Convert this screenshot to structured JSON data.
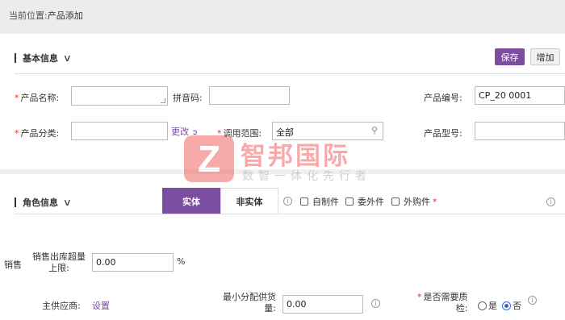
{
  "breadcrumb": {
    "prefix": "当前位置:",
    "current": "产品添加"
  },
  "basic_section": {
    "title": "基本信息",
    "save_label": "保存",
    "add_label": "增加"
  },
  "fields": {
    "product_name": {
      "label": "产品名称:",
      "value": ""
    },
    "pinyin": {
      "label": "拼音码:",
      "value": ""
    },
    "product_code": {
      "label": "产品编号:",
      "value": "CP_20          0001"
    },
    "category": {
      "label": "产品分类:",
      "value": "",
      "change_link": "更改"
    },
    "scope": {
      "label": "调用范围:",
      "value": "全部"
    },
    "model": {
      "label": "产品型号:",
      "value": ""
    }
  },
  "role_section": {
    "title": "角色信息",
    "tabs": [
      {
        "label": "实体"
      },
      {
        "label": "非实体"
      }
    ],
    "checkboxes": [
      {
        "label": "自制件"
      },
      {
        "label": "委外件"
      },
      {
        "label": "外购件"
      }
    ],
    "required_mark": "*"
  },
  "sales": {
    "side_label": "销售",
    "overlimit_label_line1": "销售出库超量",
    "overlimit_label_line2": "上限:",
    "overlimit_value": "0.00",
    "overlimit_unit": "%",
    "supplier_label": "主供应商:",
    "supplier_link": "设置",
    "min_alloc_label_line1": "最小分配供货",
    "min_alloc_label_line2": "量:",
    "min_alloc_value": "0.00",
    "qc_label_line1": "是否需要质",
    "qc_label_line2": "检:",
    "qc_yes": "是",
    "qc_no": "否"
  },
  "watermark": {
    "logo_letter": "Z",
    "name": "智邦国际",
    "slogan": "数智一体化先行者"
  },
  "colors": {
    "accent": "#7a4d9e",
    "required": "#e0342a",
    "radio_selected": "#2a6ad6"
  }
}
